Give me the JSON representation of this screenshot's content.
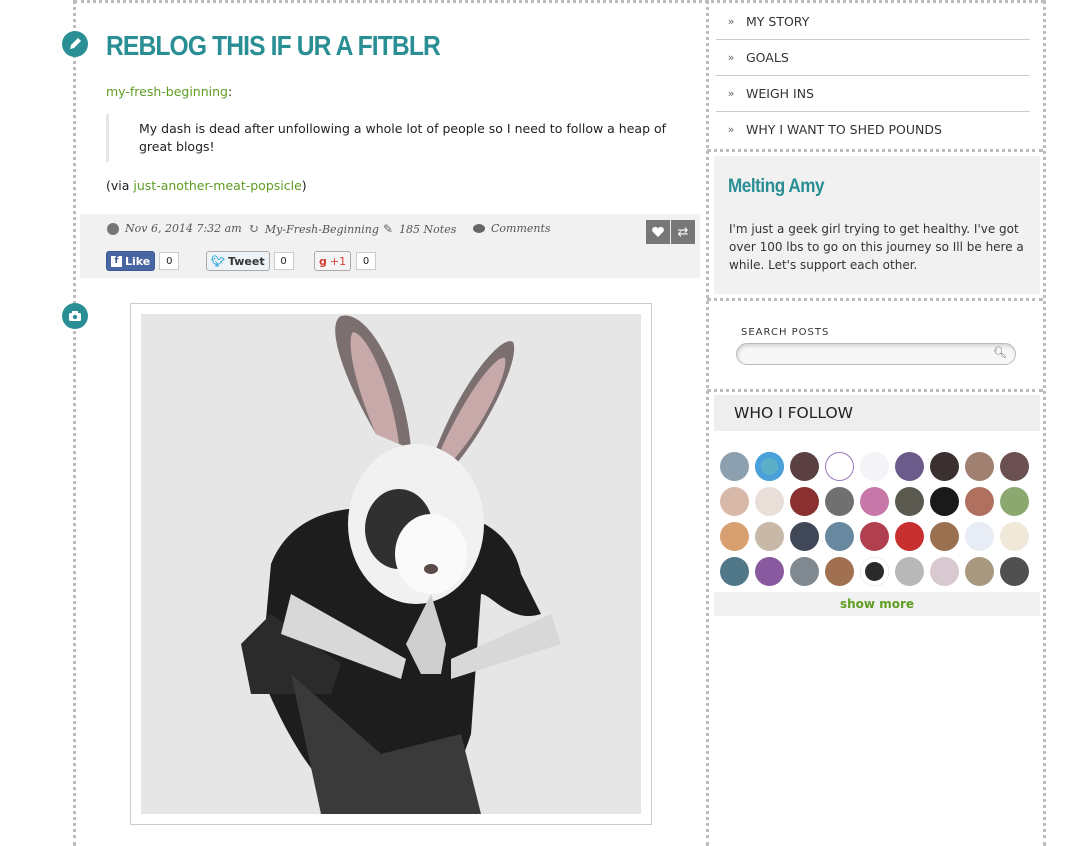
{
  "post": {
    "title": "REBLOG THIS IF UR A FITBLR",
    "source_user": "my-fresh-beginning",
    "source_colon": ":",
    "quote": "My dash is dead after unfollowing a whole lot of people so I need to follow a heap of great blogs!",
    "via_prefix": "(via ",
    "via_user": "just-another-meat-popsicle",
    "via_suffix": ")",
    "date": "Nov 6, 2014 7:32 am",
    "reblogged_from": "My-Fresh-Beginning",
    "notes": "185 Notes",
    "comments": "Comments",
    "like_label": "Like",
    "like_count": "0",
    "tweet_label": "Tweet",
    "tweet_count": "0",
    "gplus_label": "+1",
    "gplus_count": "0"
  },
  "sidebar": {
    "nav": [
      "MY STORY",
      "GOALS",
      "WEIGH INS",
      "WHY I WANT TO SHED POUNDS"
    ],
    "about_title": "Melting Amy",
    "about_text": "I'm just a geek girl trying to get healthy. I've got over 100 lbs to go on this journey so Ill be here a while. Let's support each other.",
    "search_label": "SEARCH POSTS",
    "follow_title": "WHO I FOLLOW",
    "show_more": "show more"
  },
  "colors": {
    "accent": "#2a8f95",
    "link": "#5e9c22"
  },
  "icons": {
    "text_post": "pencil-icon",
    "photo_post": "camera-icon"
  }
}
